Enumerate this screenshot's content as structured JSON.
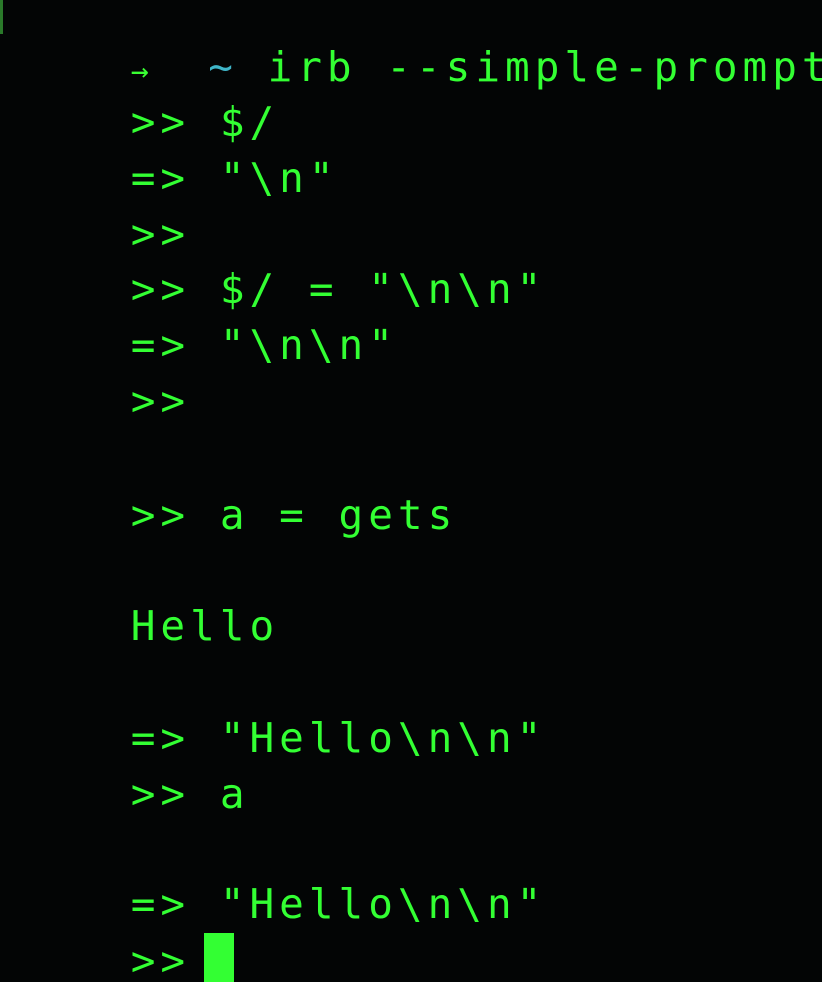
{
  "terminal": {
    "header": {
      "arrow_icon": "→",
      "tilde": "~",
      "command": "irb --simple-prompt"
    },
    "lines": [
      {
        "prompt": ">>",
        "text": "$/"
      },
      {
        "prompt": "=>",
        "text": "\"\\n\""
      },
      {
        "prompt": ">>",
        "text": ""
      },
      {
        "prompt": ">>",
        "text": "$/ = \"\\n\\n\""
      },
      {
        "prompt": "=>",
        "text": "\"\\n\\n\""
      },
      {
        "prompt": ">>",
        "text": ""
      },
      {
        "prompt": ">>",
        "text": "a = gets"
      },
      {
        "prompt": "",
        "text": "Hello"
      },
      {
        "prompt": "=>",
        "text": "\"Hello\\n\\n\""
      },
      {
        "prompt": ">>",
        "text": "a"
      },
      {
        "prompt": "=>",
        "text": "\"Hello\\n\\n\""
      },
      {
        "prompt": ">>",
        "text": ""
      }
    ]
  },
  "colors": {
    "background": "#030505",
    "text": "#33ff33",
    "tilde": "#3fb6c9",
    "cursor": "#33ff33"
  }
}
